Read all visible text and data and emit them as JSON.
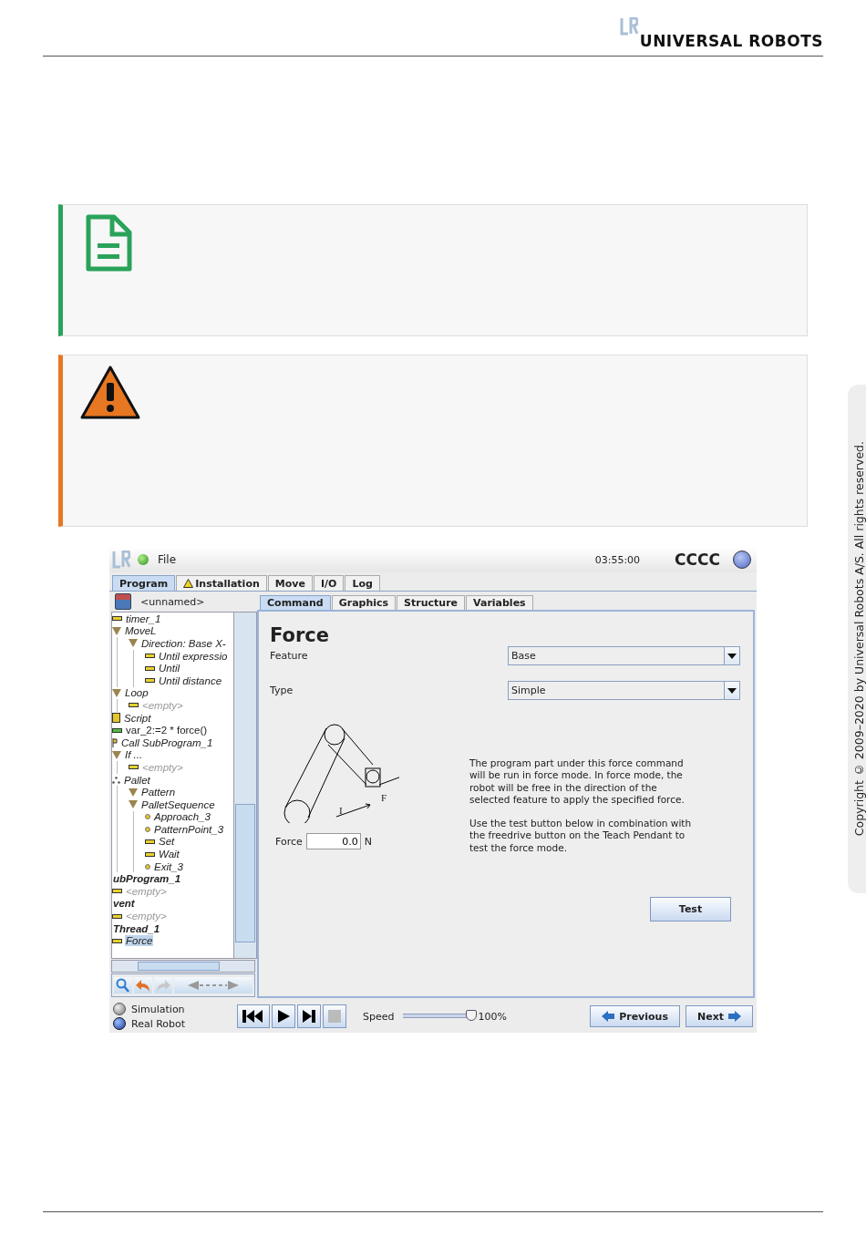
{
  "header": {
    "brand": "UNIVERSAL ROBOTS"
  },
  "note_box": {
    "kind": "note"
  },
  "warning_box": {
    "kind": "warning"
  },
  "screen": {
    "top_bar": {
      "menu": "File",
      "time": "03:55:00",
      "robot_name": "CCCC"
    },
    "tabs": [
      {
        "label": "Program",
        "selected": true,
        "kind": "plain"
      },
      {
        "label": "Installation",
        "selected": false,
        "kind": "warning"
      },
      {
        "label": "Move",
        "selected": false,
        "kind": "plain"
      },
      {
        "label": "I/O",
        "selected": false,
        "kind": "plain"
      },
      {
        "label": "Log",
        "selected": false,
        "kind": "plain"
      }
    ],
    "file_name": "<unnamed>",
    "tree": [
      {
        "label": "timer_1",
        "kind": "bar",
        "selected": false
      },
      {
        "label": "MoveL",
        "kind": "triangle",
        "selected": false,
        "children": [
          {
            "label": "Direction: Base X-",
            "kind": "triangle",
            "selected": false,
            "children": [
              {
                "label": "Until expressio",
                "kind": "bar",
                "selected": false
              },
              {
                "label": "Until",
                "kind": "bar",
                "selected": false
              },
              {
                "label": "Until distance",
                "kind": "bar",
                "selected": false
              }
            ]
          }
        ]
      },
      {
        "label": "Loop",
        "kind": "triangle",
        "selected": false,
        "children": [
          {
            "label": "<empty>",
            "kind": "empty",
            "selected": false
          }
        ]
      },
      {
        "label": "Script",
        "kind": "script",
        "selected": false
      },
      {
        "label": "var_2:=2 * force()",
        "kind": "var",
        "selected": false
      },
      {
        "label": "Call SubProgram_1",
        "kind": "call",
        "selected": false
      },
      {
        "label": "If ...",
        "kind": "triangle",
        "selected": false,
        "children": [
          {
            "label": "<empty>",
            "kind": "empty",
            "selected": false
          }
        ]
      },
      {
        "label": "Pallet",
        "kind": "pallet",
        "selected": false,
        "children": [
          {
            "label": "Pattern",
            "kind": "triangle",
            "selected": false
          },
          {
            "label": "PalletSequence",
            "kind": "triangle",
            "selected": false,
            "children": [
              {
                "label": "Approach_3",
                "kind": "dot",
                "selected": false
              },
              {
                "label": "PatternPoint_3",
                "kind": "dot",
                "selected": false
              },
              {
                "label": "Set",
                "kind": "bar",
                "selected": false
              },
              {
                "label": "Wait",
                "kind": "bar",
                "selected": false
              },
              {
                "label": "Exit_3",
                "kind": "dot",
                "selected": false
              }
            ]
          }
        ]
      },
      {
        "label": "ubProgram_1",
        "kind": "section",
        "selected": false
      },
      {
        "label": "<empty>",
        "kind": "empty",
        "selected": false
      },
      {
        "label": "vent",
        "kind": "section",
        "selected": false
      },
      {
        "label": "<empty>",
        "kind": "empty",
        "selected": false
      },
      {
        "label": "Thread_1",
        "kind": "section",
        "selected": false
      },
      {
        "label": "Force",
        "kind": "bar",
        "selected": true
      }
    ],
    "subtabs": [
      {
        "label": "Command",
        "selected": true
      },
      {
        "label": "Graphics",
        "selected": false
      },
      {
        "label": "Structure",
        "selected": false
      },
      {
        "label": "Variables",
        "selected": false
      }
    ],
    "panel": {
      "title": "Force",
      "fields": [
        {
          "label": "Feature",
          "value": "Base"
        },
        {
          "label": "Type",
          "value": "Simple"
        }
      ],
      "diagram_labels": [
        "F",
        "I"
      ],
      "force": {
        "label": "Force",
        "value": "0.0",
        "unit": "N"
      },
      "description": [
        "The program part under this force command will be run in force mode. In force mode, the robot will be free in the direction of the selected feature to apply the specified force.",
        "Use the test button below in combination with the freedrive button on the Teach Pendant to test the force mode."
      ],
      "test_button": "Test"
    },
    "modes": [
      {
        "label": "Simulation",
        "selected": false
      },
      {
        "label": "Real Robot",
        "selected": true
      }
    ],
    "speed": {
      "label": "Speed",
      "level": 1.0,
      "reading": "100%"
    },
    "nav": {
      "previous": "Previous",
      "next": "Next"
    }
  },
  "side_tab": {
    "copyright": "Copyright © 2009–2020 by Universal Robots A/S. All rights reserved."
  }
}
